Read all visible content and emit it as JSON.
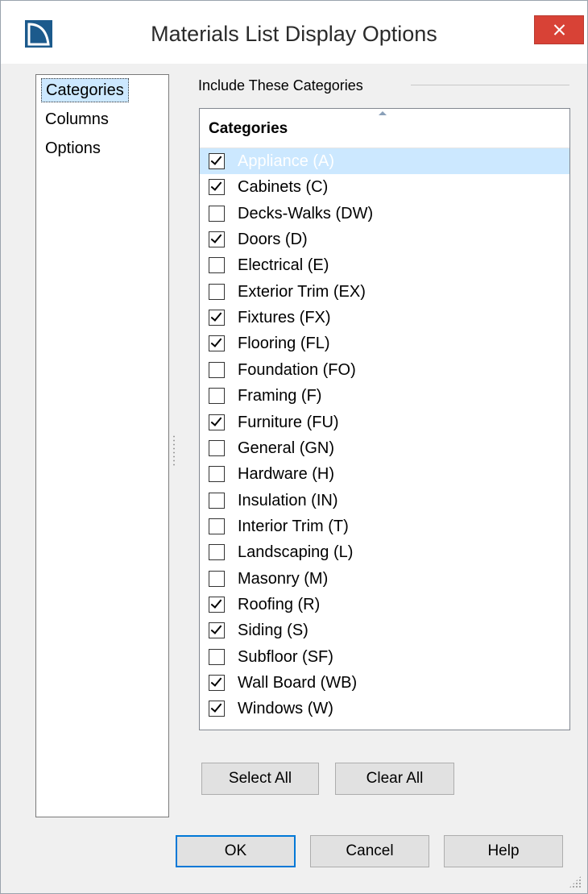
{
  "window": {
    "title": "Materials List Display Options",
    "accent": "#cce8ff",
    "close_color": "#d84236"
  },
  "nav": {
    "items": [
      {
        "label": "Categories",
        "selected": true
      },
      {
        "label": "Columns",
        "selected": false
      },
      {
        "label": "Options",
        "selected": false
      }
    ]
  },
  "group": {
    "label": "Include These Categories"
  },
  "list": {
    "header": "Categories",
    "rows": [
      {
        "label": "Appliance (A)",
        "checked": true,
        "selected": true
      },
      {
        "label": "Cabinets (C)",
        "checked": true
      },
      {
        "label": "Decks-Walks (DW)",
        "checked": false
      },
      {
        "label": "Doors (D)",
        "checked": true
      },
      {
        "label": "Electrical (E)",
        "checked": false
      },
      {
        "label": "Exterior Trim (EX)",
        "checked": false
      },
      {
        "label": "Fixtures (FX)",
        "checked": true
      },
      {
        "label": "Flooring (FL)",
        "checked": true
      },
      {
        "label": "Foundation (FO)",
        "checked": false
      },
      {
        "label": "Framing (F)",
        "checked": false
      },
      {
        "label": "Furniture (FU)",
        "checked": true
      },
      {
        "label": "General (GN)",
        "checked": false
      },
      {
        "label": "Hardware (H)",
        "checked": false
      },
      {
        "label": "Insulation (IN)",
        "checked": false
      },
      {
        "label": "Interior Trim (T)",
        "checked": false
      },
      {
        "label": "Landscaping (L)",
        "checked": false
      },
      {
        "label": "Masonry (M)",
        "checked": false
      },
      {
        "label": "Roofing (R)",
        "checked": true
      },
      {
        "label": "Siding (S)",
        "checked": true
      },
      {
        "label": "Subfloor (SF)",
        "checked": false
      },
      {
        "label": "Wall Board (WB)",
        "checked": true
      },
      {
        "label": "Windows (W)",
        "checked": true
      }
    ]
  },
  "buttons": {
    "select_all": "Select All",
    "clear_all": "Clear All",
    "ok": "OK",
    "cancel": "Cancel",
    "help": "Help"
  }
}
